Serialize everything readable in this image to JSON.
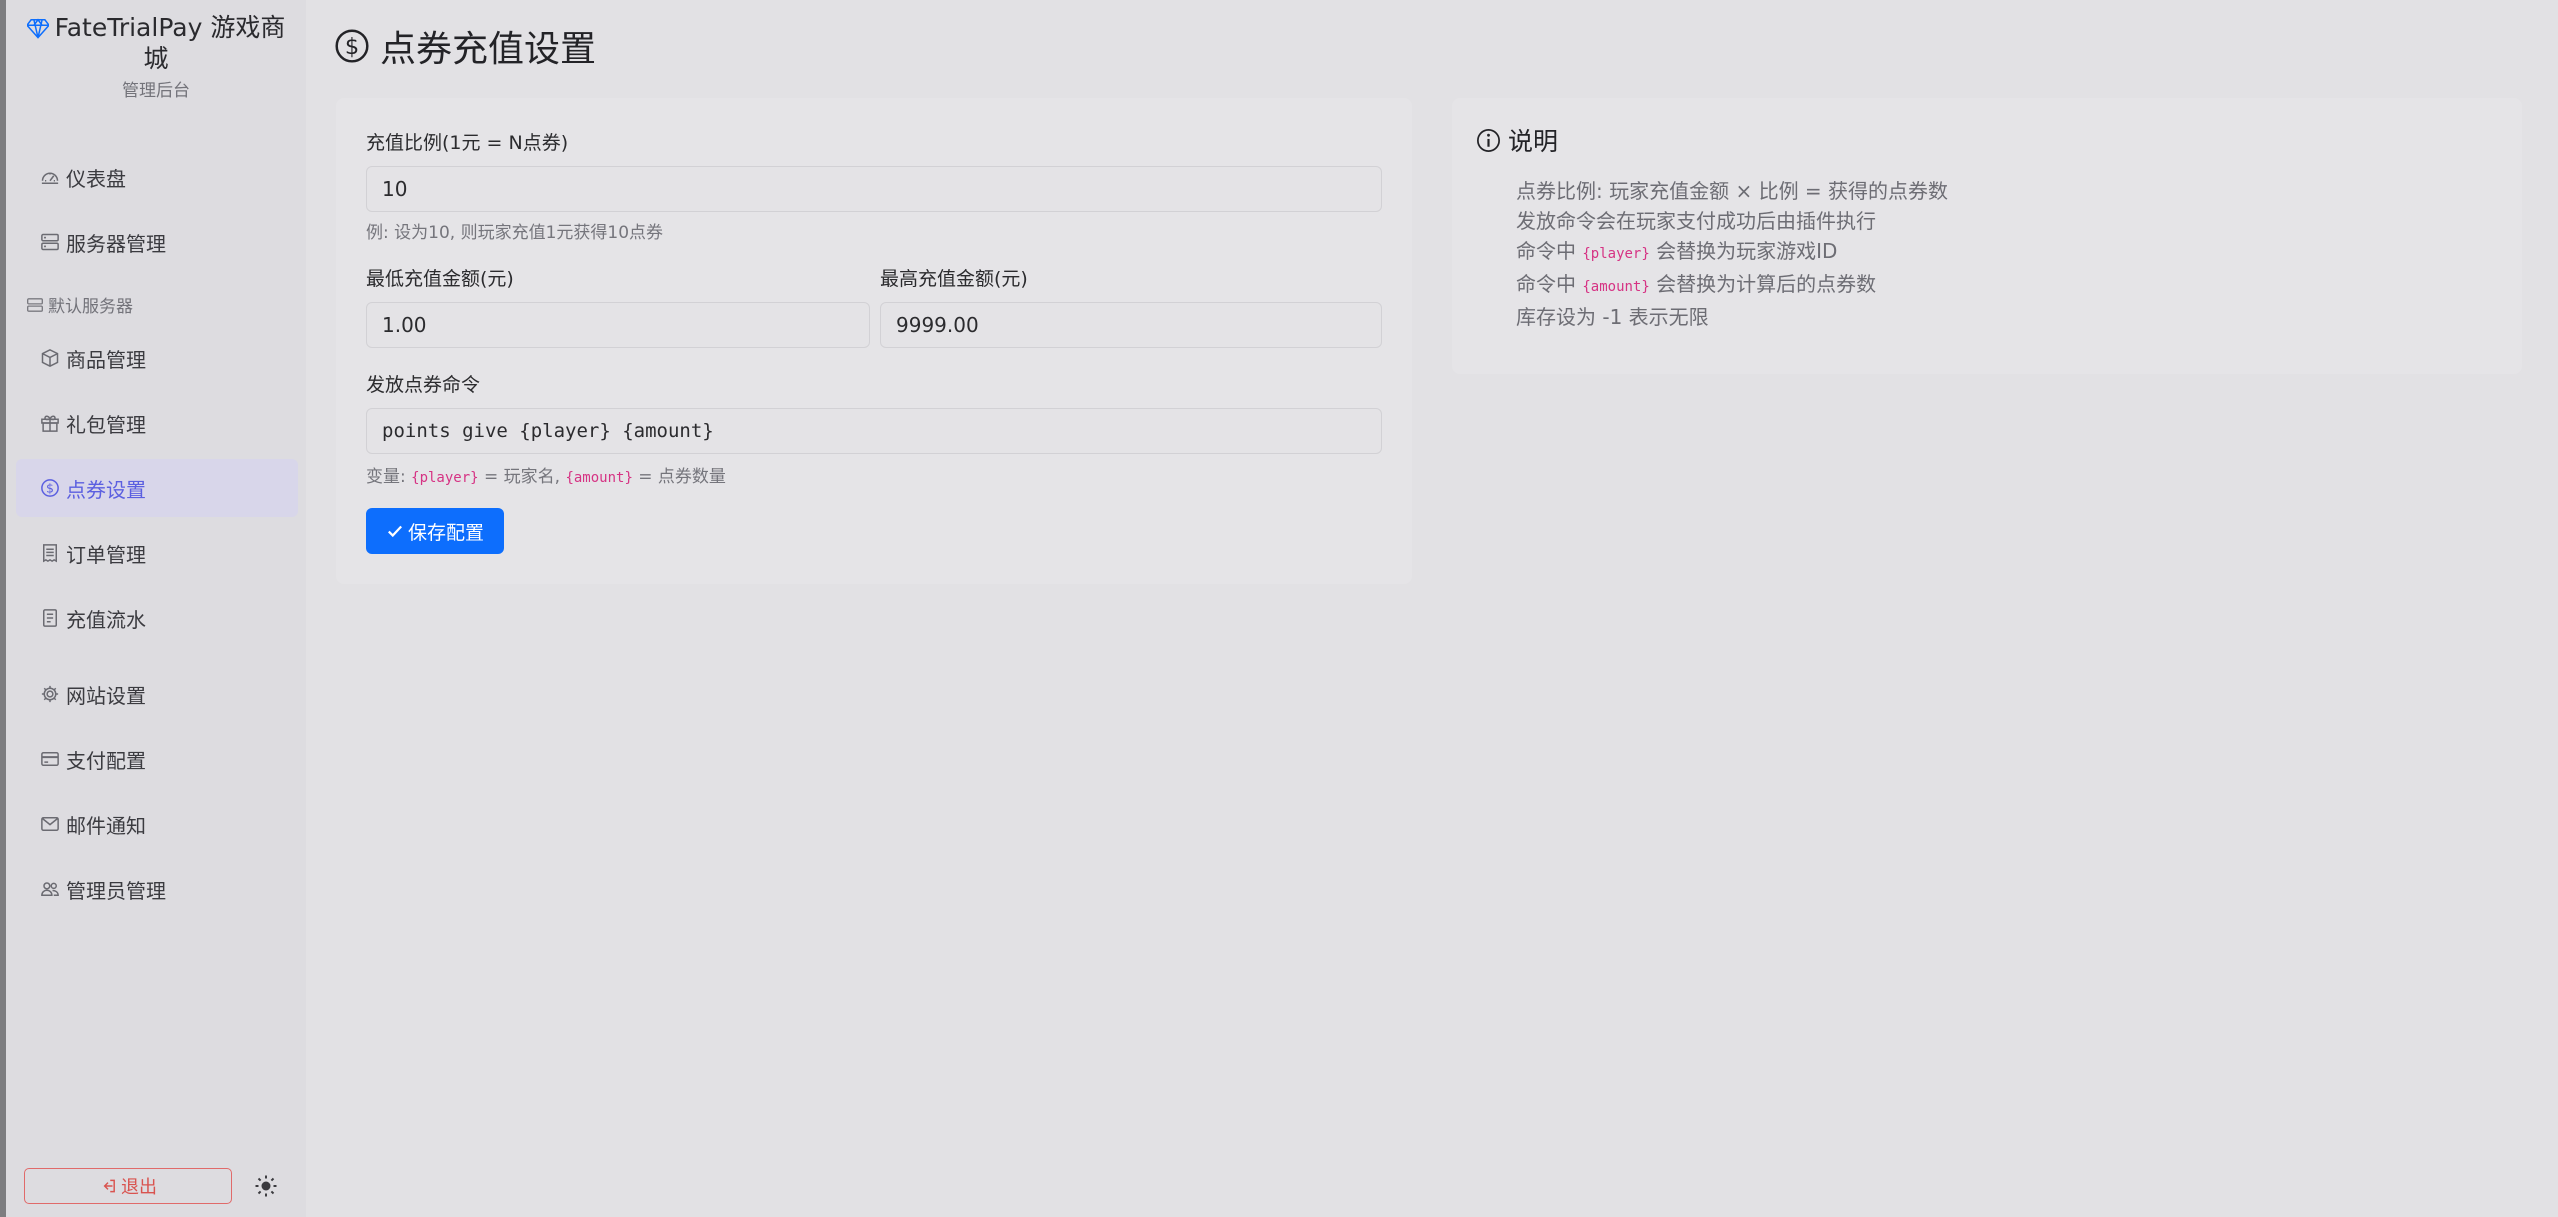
{
  "brand": {
    "title": "FateTrialPay 游戏商城",
    "subtitle": "管理后台"
  },
  "sidebar": {
    "items": [
      {
        "label": "仪表盘",
        "icon": "dashboard-icon"
      },
      {
        "label": "服务器管理",
        "icon": "server-icon"
      },
      {
        "label": "商品管理",
        "icon": "box-icon"
      },
      {
        "label": "礼包管理",
        "icon": "gift-icon"
      },
      {
        "label": "点券设置",
        "icon": "coin-icon",
        "active": true
      },
      {
        "label": "订单管理",
        "icon": "receipt-icon"
      },
      {
        "label": "充值流水",
        "icon": "ledger-icon"
      },
      {
        "label": "网站设置",
        "icon": "gear-icon"
      },
      {
        "label": "支付配置",
        "icon": "credit-card-icon"
      },
      {
        "label": "邮件通知",
        "icon": "envelope-icon"
      },
      {
        "label": "管理员管理",
        "icon": "people-icon"
      }
    ],
    "group_label": "默认服务器",
    "logout_label": "退出"
  },
  "page": {
    "title": "点券充值设置"
  },
  "form": {
    "ratio_label": "充值比例(1元 = N点券)",
    "ratio_value": "10",
    "ratio_hint": "例: 设为10, 则玩家充值1元获得10点券",
    "min_label": "最低充值金额(元)",
    "min_value": "1.00",
    "max_label": "最高充值金额(元)",
    "max_value": "9999.00",
    "command_label": "发放点券命令",
    "command_value": "points give {player} {amount}",
    "command_hint": {
      "prefix": "变量: ",
      "var_player": "{player}",
      "player_desc": " = 玩家名, ",
      "var_amount": "{amount}",
      "amount_desc": " = 点券数量"
    },
    "save_label": "保存配置"
  },
  "info": {
    "title": "说明",
    "line1": "点券比例: 玩家充值金额 × 比例 = 获得的点券数",
    "line2": "发放命令会在玩家支付成功后由插件执行",
    "line3_prefix": "命令中 ",
    "line3_var": "{player}",
    "line3_suffix": " 会替换为玩家游戏ID",
    "line4_prefix": "命令中 ",
    "line4_var": "{amount}",
    "line4_suffix": " 会替换为计算后的点券数",
    "line5": "库存设为 -1 表示无限"
  },
  "colors": {
    "accent": "#0d6efd",
    "active_nav": "#5b5fe0",
    "danger": "#d9534f",
    "code": "#d63384"
  }
}
